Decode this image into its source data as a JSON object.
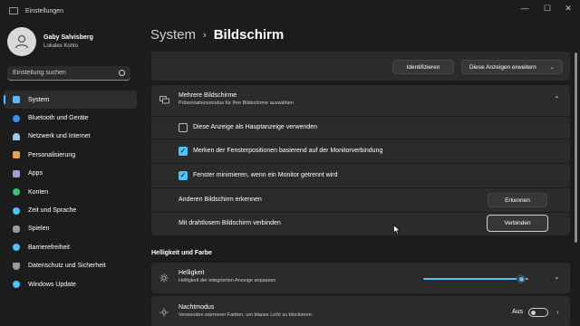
{
  "window": {
    "title": "Einstellungen"
  },
  "user": {
    "name": "Gaby Salvisberg",
    "account": "Lokales Konto"
  },
  "search": {
    "placeholder": "Einstellung suchen"
  },
  "nav": [
    {
      "label": "System",
      "icon": "system-icon",
      "color": "#4cc2ff",
      "active": true
    },
    {
      "label": "Bluetooth und Geräte",
      "icon": "bluetooth-icon",
      "color": "#3a8ee6"
    },
    {
      "label": "Netzwerk und Internet",
      "icon": "network-icon",
      "color": "#9cc8f0"
    },
    {
      "label": "Personalisierung",
      "icon": "brush-icon",
      "color": "#e6a34a"
    },
    {
      "label": "Apps",
      "icon": "apps-icon",
      "color": "#9d9de0"
    },
    {
      "label": "Konten",
      "icon": "account-icon",
      "color": "#3fbf7f"
    },
    {
      "label": "Zeit und Sprache",
      "icon": "globe-clock-icon",
      "color": "#4cc2ff"
    },
    {
      "label": "Spielen",
      "icon": "gamepad-icon",
      "color": "#9a9a9a"
    },
    {
      "label": "Barrierefreiheit",
      "icon": "accessibility-icon",
      "color": "#4cc2ff"
    },
    {
      "label": "Datenschutz und Sicherheit",
      "icon": "shield-icon",
      "color": "#9a9a9a"
    },
    {
      "label": "Windows Update",
      "icon": "update-icon",
      "color": "#4cc2ff"
    }
  ],
  "breadcrumb": {
    "parent": "System",
    "separator": "›",
    "current": "Bildschirm"
  },
  "top": {
    "identify": "Identifizieren",
    "extend": "Diese Anzeigen erweitern"
  },
  "multi": {
    "title": "Mehrere Bildschirme",
    "subtitle": "Präsentationsmodus für Ihre Bildschirme auswählen",
    "main_display": "Diese Anzeige als Hauptanzeige verwenden",
    "remember": "Merken der Fensterpositionen basierend auf der Monitorverbindung",
    "minimize": "Fenster minimieren, wenn ein Monitor getrennt wird",
    "detect_label": "Anderen Bildschirm erkennen",
    "detect_button": "Erkennen",
    "wireless_label": "Mit drahtlosem Bildschirm verbinden",
    "wireless_button": "Verbinden"
  },
  "section": {
    "brightness_color": "Helligkeit und Farbe"
  },
  "brightness": {
    "title": "Helligkeit",
    "subtitle": "Helligkeit der integrierten Anzeige anpassen",
    "level_fraction": 0.9
  },
  "night": {
    "title": "Nachtmodus",
    "subtitle": "Verwenden wärmerer Farben, um blaues Licht zu blockieren.",
    "state": "Aus"
  },
  "colors": {
    "accent": "#4cc2ff",
    "background": "#1c1c1c",
    "card": "#2b2b2b"
  }
}
